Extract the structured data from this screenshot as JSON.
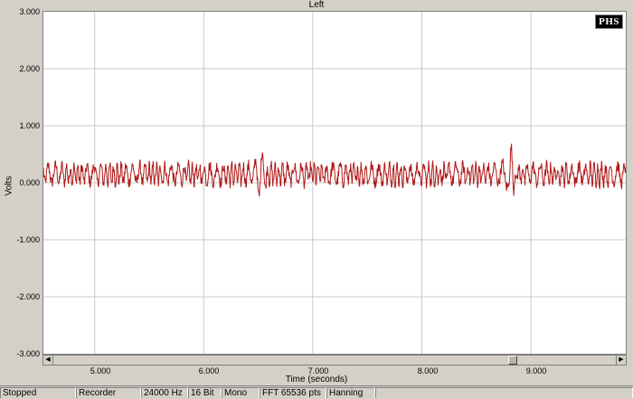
{
  "plot": {
    "title": "Left",
    "y_label": "Volts",
    "x_label": "Time (seconds)",
    "logo": "PHS",
    "y_ticks": [
      "3.000",
      "2.000",
      "1.000",
      "0.000",
      "-1.000",
      "-2.000",
      "-3.000"
    ],
    "x_ticks": [
      "5.000",
      "6.000",
      "7.000",
      "8.000",
      "9.000"
    ]
  },
  "scrollbar": {
    "position": 0.82
  },
  "status": {
    "state": "Stopped",
    "mode": "Recorder",
    "sample_rate": "24000 Hz",
    "bit_depth": "16 Bit",
    "channels": "Mono",
    "fft": "FFT 65536 pts",
    "window": "Hanning"
  },
  "chart_data": {
    "type": "line",
    "title": "Left",
    "xlabel": "Time (seconds)",
    "ylabel": "Volts",
    "xlim": [
      4.53,
      9.87
    ],
    "ylim": [
      -3.0,
      3.0
    ],
    "grid": true,
    "series": [
      {
        "color": "#b01818",
        "baseline": 0.15,
        "noise_amplitude": 0.15,
        "events": [
          {
            "x": 6.52,
            "amplitude": 0.3
          },
          {
            "x": 8.8,
            "amplitude": 0.42
          }
        ]
      }
    ]
  }
}
